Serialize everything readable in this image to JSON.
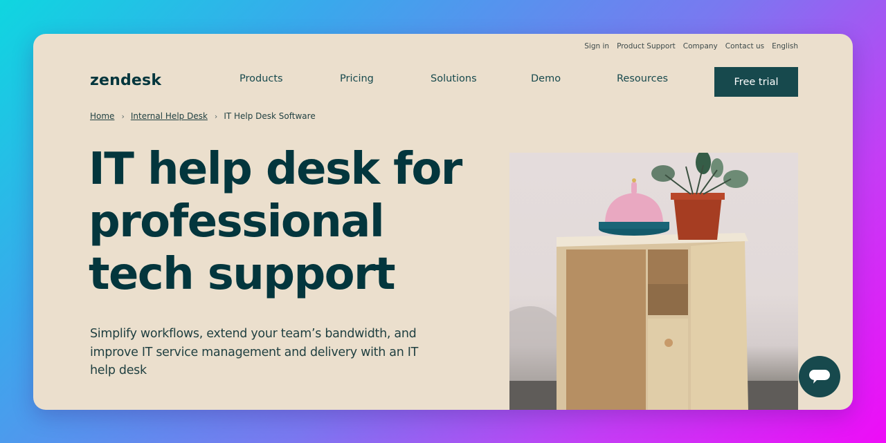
{
  "utility_nav": [
    "Sign in",
    "Product Support",
    "Company",
    "Contact us",
    "English"
  ],
  "brand": {
    "logo_text": "zendesk"
  },
  "main_nav": [
    "Products",
    "Pricing",
    "Solutions",
    "Demo",
    "Resources"
  ],
  "cta": {
    "label": "Free trial"
  },
  "breadcrumb": [
    {
      "label": "Home",
      "link": true
    },
    {
      "label": "Internal Help Desk",
      "link": true
    },
    {
      "label": "IT Help Desk Software",
      "link": false
    }
  ],
  "breadcrumb_separator": "›",
  "hero": {
    "headline_lines": [
      "IT help desk for",
      "professional",
      "tech support"
    ],
    "subtitle": "Simplify workflows, extend your team’s bandwidth, and improve IT service management and delivery with an IT help desk",
    "image_alt": "Wooden desk with pink service bell and potted plant"
  },
  "chat_widget": {
    "icon": "chat-bubble-icon"
  },
  "colors": {
    "card_bg": "#ebdfcd",
    "brand_dark": "#03363d",
    "cta_bg": "#17494d"
  }
}
